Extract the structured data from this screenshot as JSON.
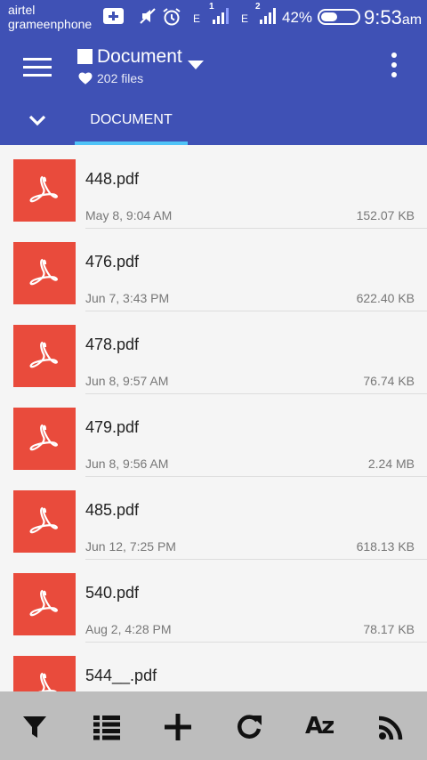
{
  "statusbar": {
    "carrier1": "airtel",
    "carrier2": "grameenphone",
    "sim1_type": "E",
    "sim1_num": "1",
    "sim2_type": "E",
    "sim2_num": "2",
    "battery": "42%",
    "time": "9:53",
    "ampm": "am",
    "battery_level": 0.42
  },
  "toolbar": {
    "title": "Document",
    "subtitle": "202 files"
  },
  "tabs": [
    {
      "label": "DOCUMENT",
      "active": true
    }
  ],
  "files": [
    {
      "name": "448.pdf",
      "date": "May 8, 9:04 AM",
      "size": "152.07 KB"
    },
    {
      "name": "476.pdf",
      "date": "Jun 7, 3:43 PM",
      "size": "622.40 KB"
    },
    {
      "name": "478.pdf",
      "date": "Jun 8, 9:57 AM",
      "size": "76.74 KB"
    },
    {
      "name": "479.pdf",
      "date": "Jun 8, 9:56 AM",
      "size": "2.24 MB"
    },
    {
      "name": "485.pdf",
      "date": "Jun 12, 7:25 PM",
      "size": "618.13 KB"
    },
    {
      "name": "540.pdf",
      "date": "Aug 2, 4:28 PM",
      "size": "78.17 KB"
    },
    {
      "name": "544__.pdf",
      "date": "",
      "size": ""
    }
  ],
  "bottombar": {
    "buttons": [
      "filter-icon",
      "list-view-icon",
      "add-icon",
      "refresh-icon",
      "sort-az-icon",
      "wifi-share-icon"
    ],
    "sort_label": "Az"
  },
  "colors": {
    "primary": "#3f51b5",
    "tab_indicator": "#4fc3f7",
    "pdf_icon": "#e94b3c",
    "bottombar": "#bdbdbd"
  }
}
